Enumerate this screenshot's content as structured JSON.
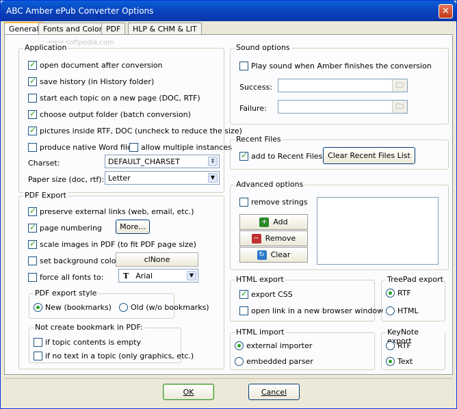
{
  "window": {
    "title": "ABC Amber ePub Converter Options",
    "close_glyph": "✕"
  },
  "tabs": [
    "General",
    "Fonts and Colors",
    "PDF",
    "HLP & CHM & LIT"
  ],
  "application": {
    "title": "Application",
    "open_doc": "open document after conversion",
    "save_history": "save history (in History folder)",
    "new_page": "start each topic on a new page (DOC, RTF)",
    "choose_folder": "choose output folder (batch conversion)",
    "pictures": "pictures inside RTF, DOC (uncheck to reduce the size)",
    "native_word": "produce native Word file",
    "multi_instances": "allow multiple instances",
    "charset_label": "Charset:",
    "charset_value": "DEFAULT_CHARSET",
    "paper_label": "Paper size (doc, rtf):",
    "paper_value": "Letter"
  },
  "pdf_export": {
    "title": "PDF Export",
    "preserve_links": "preserve external links (web, email, etc.)",
    "page_numbering": "page numbering",
    "more_button": "More...",
    "scale_images": "scale images in PDF (to fit PDF page size)",
    "set_background": "set background color",
    "background_value": "clNone",
    "force_fonts": "force all fonts to:",
    "font_value": "Arial",
    "style_title": "PDF export style",
    "style_new": "New (bookmarks)",
    "style_old": "Old (w/o bookmarks)",
    "nobookmark_title": "Not create bookmark in PDF:",
    "if_empty": "if topic contents is empty",
    "if_no_text": "if no text in a topic (only graphics, etc.)"
  },
  "sound": {
    "title": "Sound options",
    "play": "Play sound when Amber finishes the conversion",
    "success_label": "Success:",
    "failure_label": "Failure:",
    "success_value": "",
    "failure_value": ""
  },
  "recent": {
    "title": "Recent Files",
    "add": "add to Recent Files",
    "clear_button": "Clear Recent Files List"
  },
  "advanced": {
    "title": "Advanced options",
    "remove_strings": "remove strings",
    "add_button": "Add",
    "remove_button": "Remove",
    "clear_button": "Clear"
  },
  "html_export": {
    "title": "HTML export",
    "export_css": "export CSS",
    "open_new_window": "open link in a new browser window"
  },
  "treepad": {
    "title": "TreePad export",
    "rtf": "RTF",
    "html": "HTML"
  },
  "html_import": {
    "title": "HTML import",
    "external": "external importer",
    "embedded": "embedded parser"
  },
  "keynote": {
    "title": "KeyNote export",
    "rtf": "RTF",
    "text": "Text"
  },
  "footer": {
    "ok": "OK",
    "cancel": "Cancel"
  },
  "watermark": "www.softpedia.com"
}
